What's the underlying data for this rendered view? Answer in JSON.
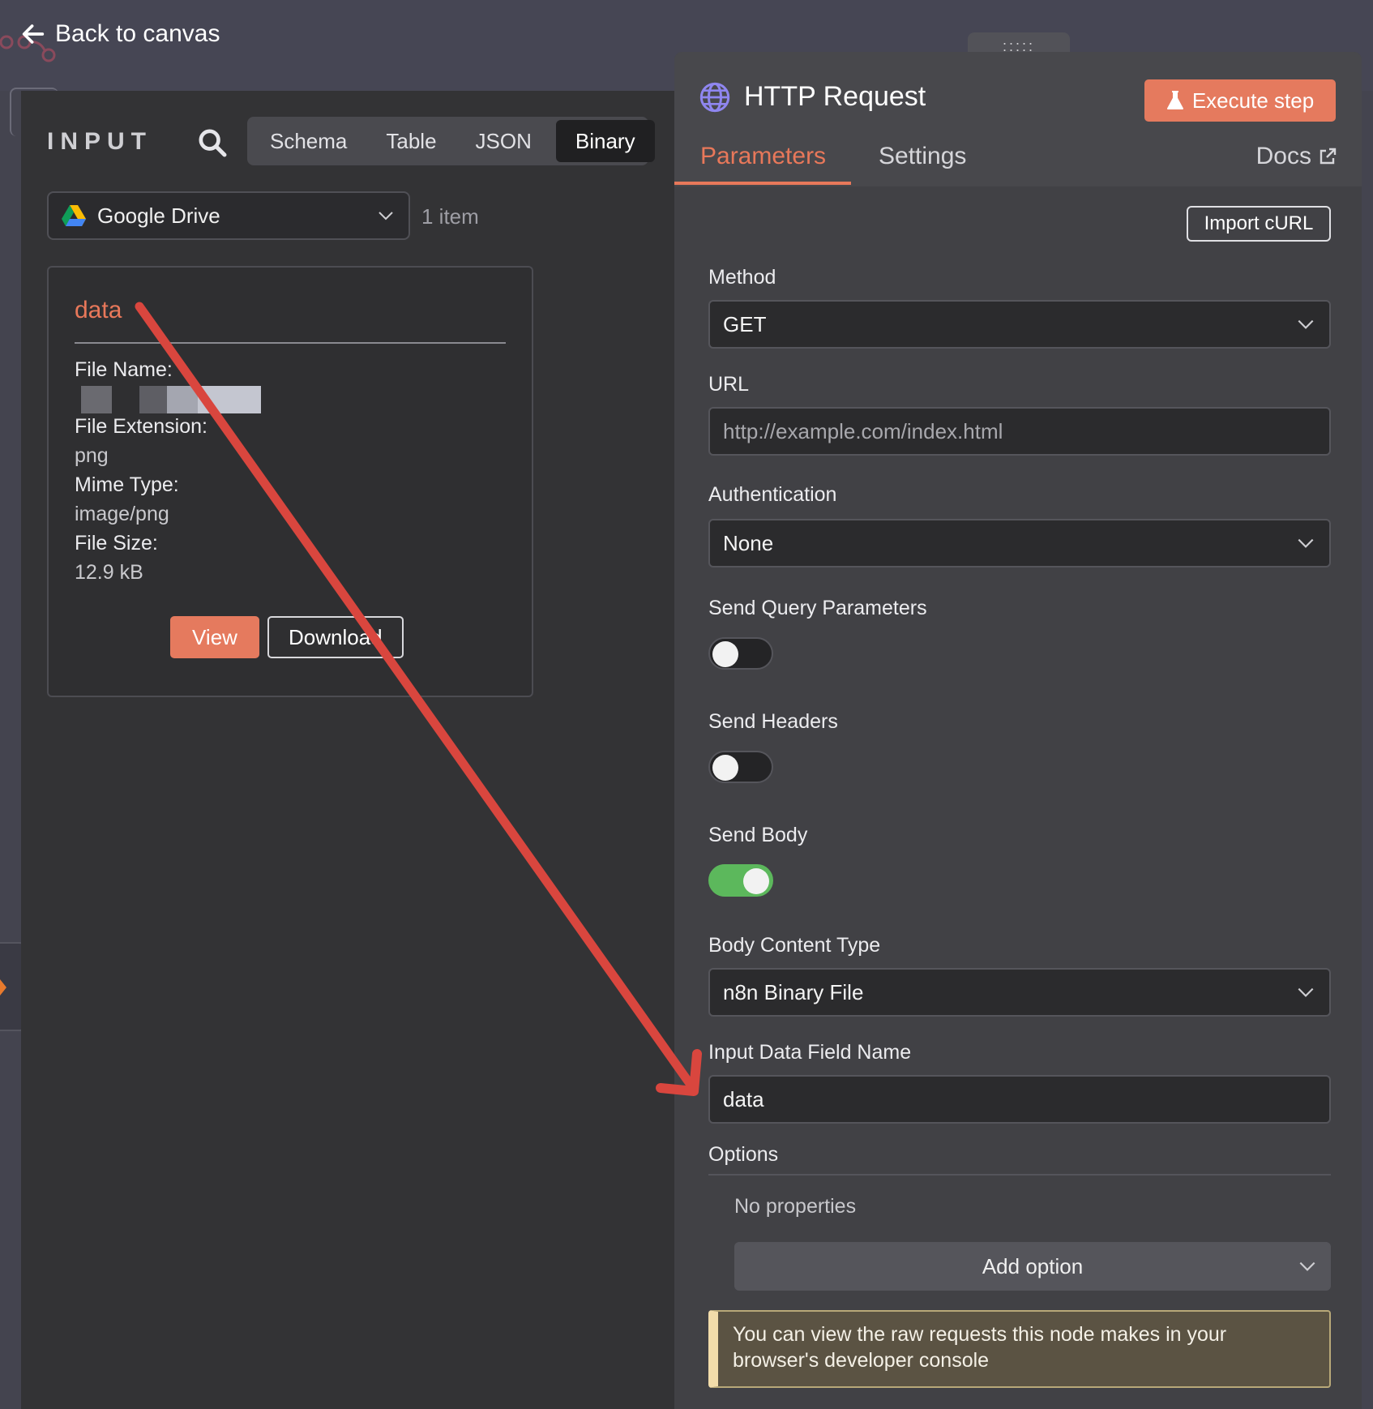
{
  "topbar": {
    "back_label": "Back to canvas"
  },
  "input": {
    "heading": "INPUT",
    "view_tabs": [
      "Schema",
      "Table",
      "JSON",
      "Binary"
    ],
    "active_view": "Binary",
    "source": {
      "label": "Google Drive",
      "count": "1 item"
    },
    "binary": {
      "key": "data",
      "fields": [
        {
          "label": "File Name:",
          "value": ""
        },
        {
          "label": "File Extension:",
          "value": "png"
        },
        {
          "label": "Mime Type:",
          "value": "image/png"
        },
        {
          "label": "File Size:",
          "value": "12.9 kB"
        }
      ],
      "view_label": "View",
      "download_label": "Download"
    }
  },
  "node": {
    "drag_handle": ":::::",
    "title": "HTTP Request",
    "execute_label": "Execute step",
    "tabs": {
      "parameters": "Parameters",
      "settings": "Settings",
      "docs": "Docs"
    },
    "import_curl": "Import cURL",
    "method": {
      "label": "Method",
      "value": "GET"
    },
    "url": {
      "label": "URL",
      "placeholder": "http://example.com/index.html"
    },
    "authentication": {
      "label": "Authentication",
      "value": "None"
    },
    "send_query": {
      "label": "Send Query Parameters",
      "on": false
    },
    "send_headers": {
      "label": "Send Headers",
      "on": false
    },
    "send_body": {
      "label": "Send Body",
      "on": true
    },
    "body_content_type": {
      "label": "Body Content Type",
      "value": "n8n Binary File"
    },
    "input_data_field": {
      "label": "Input Data Field Name",
      "value": "data"
    },
    "options": {
      "label": "Options",
      "empty": "No properties",
      "add_label": "Add option"
    },
    "notice": "You can view the raw requests this node makes in your browser's developer console"
  },
  "colors": {
    "accent": "#e8785a",
    "toggle_on": "#5cb85c",
    "annotation_arrow": "#d9463e"
  }
}
